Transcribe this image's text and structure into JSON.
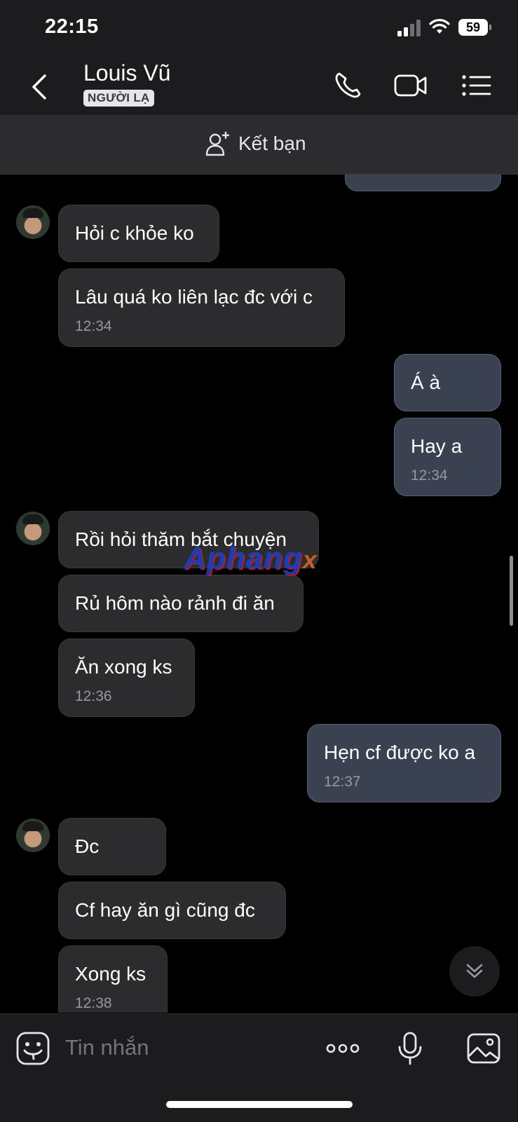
{
  "status": {
    "time": "22:15",
    "battery": "59"
  },
  "header": {
    "name": "Louis Vũ",
    "badge": "NGƯỜI LẠ"
  },
  "friend_bar": {
    "label": "Kết bạn"
  },
  "messages": [
    {
      "text": "Hỏi c khỏe ko"
    },
    {
      "text": "Lâu quá ko liên lạc đc với c",
      "time": "12:34"
    },
    {
      "text": "Á à"
    },
    {
      "text": "Hay a",
      "time": "12:34"
    },
    {
      "text": "Rồi hỏi thăm bắt chuyện"
    },
    {
      "text": "Rủ hôm nào rảnh đi ăn"
    },
    {
      "text": "Ăn xong ks",
      "time": "12:36"
    },
    {
      "text": "Hẹn cf được ko a",
      "time": "12:37"
    },
    {
      "text": "Đc"
    },
    {
      "text": "Cf hay ăn gì cũng đc"
    },
    {
      "text": "Xong ks",
      "time": "12:38"
    }
  ],
  "watermark": {
    "main": "Aphang",
    "tail": "x"
  },
  "composer": {
    "placeholder": "Tin nhắn"
  }
}
